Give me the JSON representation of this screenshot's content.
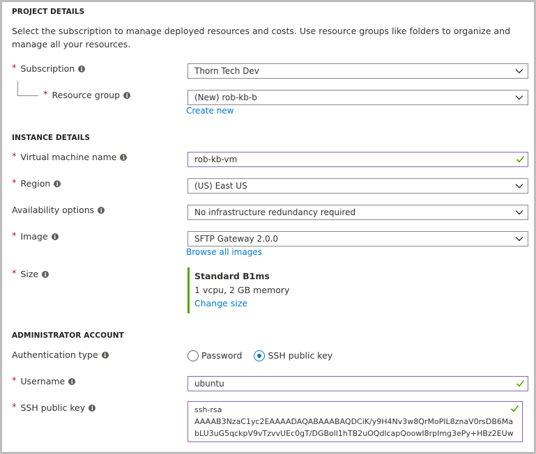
{
  "project": {
    "title": "PROJECT DETAILS",
    "description": "Select the subscription to manage deployed resources and costs. Use resource groups like folders to organize and manage all your resources.",
    "subscription_label": "Subscription",
    "subscription_value": "Thorn Tech Dev",
    "resource_group_label": "Resource group",
    "resource_group_value": "(New) rob-kb-b",
    "create_new_link": "Create new"
  },
  "instance": {
    "title": "INSTANCE DETAILS",
    "vm_name_label": "Virtual machine name",
    "vm_name_value": "rob-kb-vm",
    "region_label": "Region",
    "region_value": "(US) East US",
    "availability_label": "Availability options",
    "availability_value": "No infrastructure redundancy required",
    "image_label": "Image",
    "image_value": "SFTP Gateway 2.0.0",
    "browse_images_link": "Browse all images",
    "size_label": "Size",
    "size_name": "Standard B1ms",
    "size_spec": "1 vcpu, 2 GB memory",
    "change_size_link": "Change size"
  },
  "admin": {
    "title": "ADMINISTRATOR ACCOUNT",
    "auth_type_label": "Authentication type",
    "auth_options": [
      "Password",
      "SSH public key"
    ],
    "auth_selected": "SSH public key",
    "username_label": "Username",
    "username_value": "ubuntu",
    "ssh_key_label": "SSH public key",
    "ssh_key_lines": [
      "ssh-rsa",
      "AAAAB3NzaC1yc2EAAAADAQABAAABAQDCiK/y9H4Nv3w8QrMoPIL8znaV0rsDB6Ma",
      "bLU3uG5qckpV9vTzvvUEc0gT/DGBoll1hTB2uOQdlcapQoowI8rpImg3ePy+HBz2EUw"
    ]
  },
  "icons": {
    "info": "info-icon",
    "chevron": "chevron-down-icon",
    "check": "check-icon"
  },
  "colors": {
    "required": "#a4262c",
    "link": "#0078d4",
    "valid_border": "#8764b8",
    "valid_check": "#57a300",
    "size_accent": "#57a300"
  }
}
